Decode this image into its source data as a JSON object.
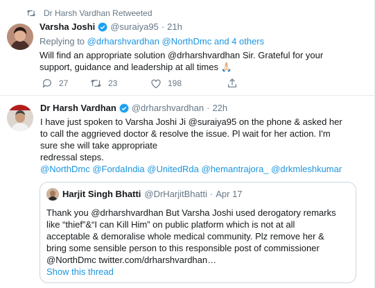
{
  "colors": {
    "accent": "#1b95e0",
    "muted": "#657786",
    "text": "#14171a",
    "border": "#e6ecf0"
  },
  "tweet1": {
    "retweet_label": "Dr Harsh Vardhan Retweeted",
    "name": "Varsha Joshi",
    "handle": "@suraiya95",
    "time": "21h",
    "replying_prefix": "Replying to",
    "replying_targets": "@drharshvardhan @NorthDmc and 4 others",
    "text_lines": [
      "Will find an appropriate solution @drharshvardhan  Sir. Grateful for your",
      "support, guidance and leadership at all times 🙏🏻"
    ],
    "reply_count": "27",
    "retweet_count": "23",
    "like_count": "198"
  },
  "tweet2": {
    "name": "Dr Harsh Vardhan",
    "handle": "@drharshvardhan",
    "time": "22h",
    "text_lines": [
      "I have just spoken to Varsha Joshi Ji @suraiya95 on the phone & asked her",
      "to call the aggrieved doctor & resolve the issue. Pl wait for her action. I'm",
      "sure she will take appropriate",
      "redressal steps.",
      "@NorthDmc @FordaIndia @UnitedRda @hemantrajora_  @drkmleshkumar"
    ],
    "quote": {
      "name": "Harjit Singh Bhatti",
      "handle": "@DrHarjitBhatti",
      "date": "Apr 17",
      "text_lines": [
        "Thank you @drharshvardhan But Varsha Joshi used derogatory remarks",
        "like “thief”&“I can Kill Him” on public platform which is not at all",
        "acceptable & demoralise whole medical community. Plz remove her &",
        "bring some sensible person to this responsible post of commissioner",
        "@NorthDmc twitter.com/drharshvardhan…"
      ],
      "show_thread": "Show this thread"
    }
  }
}
